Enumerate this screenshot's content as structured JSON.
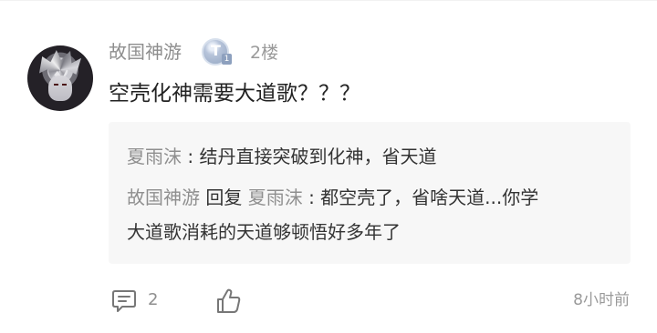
{
  "comment": {
    "username": "故国神游",
    "level_badge_letter": "T",
    "level_badge_number": "1",
    "floor": "2楼",
    "text": "空壳化神需要大道歌？？？"
  },
  "replies": [
    {
      "author": "夏雨沫",
      "separator": " : ",
      "text": "结丹直接突破到化神，省天道"
    },
    {
      "author": "故国神游",
      "reply_word": "回复",
      "target": "夏雨沫",
      "separator": " : ",
      "text_line1": "都空壳了，省啥天道...你学",
      "text_line2": "大道歌消耗的天道够顿悟好多年了"
    }
  ],
  "actions": {
    "comment_count": "2",
    "time": "8小时前"
  }
}
